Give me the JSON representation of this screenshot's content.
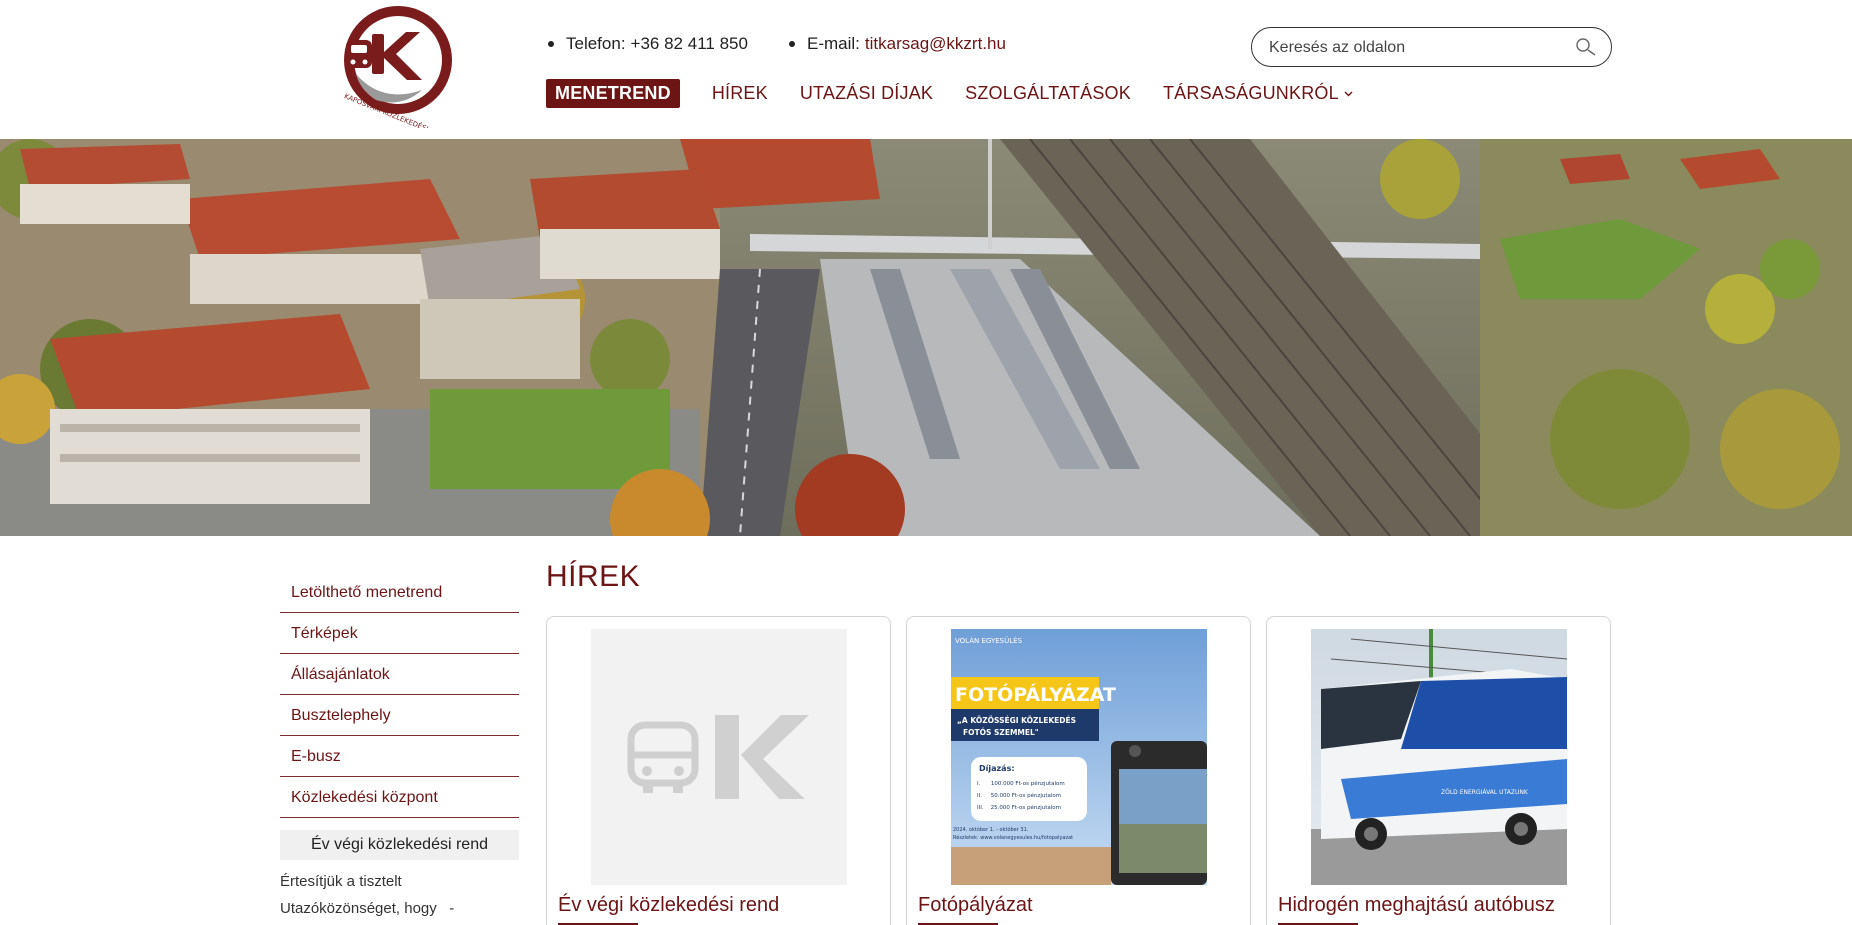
{
  "brand": {
    "logo_text": "KAPOSVÁRI KÖZLEKEDÉSI ZRT.",
    "logo_letter": "K",
    "color_primary": "#6d1414"
  },
  "contact": {
    "phone_label": "Telefon:",
    "phone_value": "+36 82 411 850",
    "email_label": "E-mail:",
    "email_value": "titkarsag@kkzrt.hu"
  },
  "search": {
    "placeholder": "Keresés az oldalon",
    "icon": "search-icon"
  },
  "nav": {
    "items": [
      {
        "label": "MENETREND",
        "active": true
      },
      {
        "label": "HÍREK",
        "active": false
      },
      {
        "label": "UTAZÁSI DÍJAK",
        "active": false
      },
      {
        "label": "SZOLGÁLTATÁSOK",
        "active": false
      },
      {
        "label": "TÁRSASÁGUNKRÓL",
        "active": false,
        "icon": "chevron-down-icon"
      }
    ]
  },
  "sidebar": {
    "items": [
      {
        "label": "Letölthető menetrend"
      },
      {
        "label": "Térképek"
      },
      {
        "label": "Állásajánlatok"
      },
      {
        "label": "Busztelephely"
      },
      {
        "label": "E-busz"
      },
      {
        "label": "Közlekedési központ"
      }
    ],
    "news_title": "Év végi közlekedési rend",
    "news_line1": "Értesítjük a tisztelt",
    "news_line2": "Utazóközönséget, hogy   -"
  },
  "main": {
    "title": "HÍREK",
    "cards": [
      {
        "title": "Év végi közlekedési rend",
        "image": "placeholder-logo"
      },
      {
        "title": "Fotópályázat",
        "image": "photo-contest-poster",
        "poster": {
          "org": "VOLÁN      EGYESÜLÉS",
          "headline": "FOTÓPÁLYÁZAT",
          "subtitle1": "„A KÖZÖSSÉGI KÖZLEKEDÉS",
          "subtitle2": "FOTÓS SZEMMEL\"",
          "prize_title": "Díjazás:",
          "prizes": [
            "I.      100.000 Ft-os pénzjutalom",
            "II.     50.000 Ft-os pénzjutalom",
            "III.    25.000 Ft-os pénzjutalom"
          ],
          "dates": "2024. október 1. - október 31.",
          "url": "Részletek: www.volanegyesules.hu/fotopalyazat"
        }
      },
      {
        "title": "Hidrogén meghajtású autóbusz",
        "image": "hydrogen-bus-photo",
        "bus_text": "ZÖLD ENERGIÁVAL UTAZUNK"
      }
    ]
  }
}
